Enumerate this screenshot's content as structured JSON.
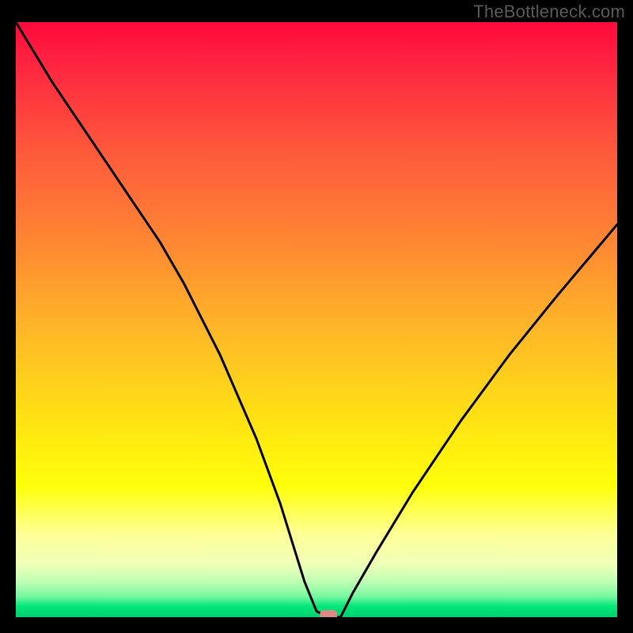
{
  "watermark": "TheBottleneck.com",
  "chart_data": {
    "type": "line",
    "title": "",
    "xlabel": "",
    "ylabel": "",
    "xlim": [
      0,
      100
    ],
    "ylim": [
      0,
      100
    ],
    "grid": false,
    "legend": false,
    "annotations": [],
    "marker": {
      "x": 52,
      "y": 0,
      "color": "#d98a84",
      "shape": "rounded-rect"
    },
    "series": [
      {
        "name": "curve",
        "color": "#000000",
        "x": [
          0,
          6,
          12,
          18,
          24,
          28,
          34,
          40,
          44,
          48,
          50,
          52,
          54,
          56,
          60,
          66,
          74,
          82,
          90,
          100
        ],
        "values": [
          100,
          90,
          81,
          72,
          63,
          56,
          44,
          30,
          19,
          6,
          1,
          0,
          0,
          4,
          11,
          21,
          33,
          44,
          54,
          66
        ]
      }
    ]
  }
}
